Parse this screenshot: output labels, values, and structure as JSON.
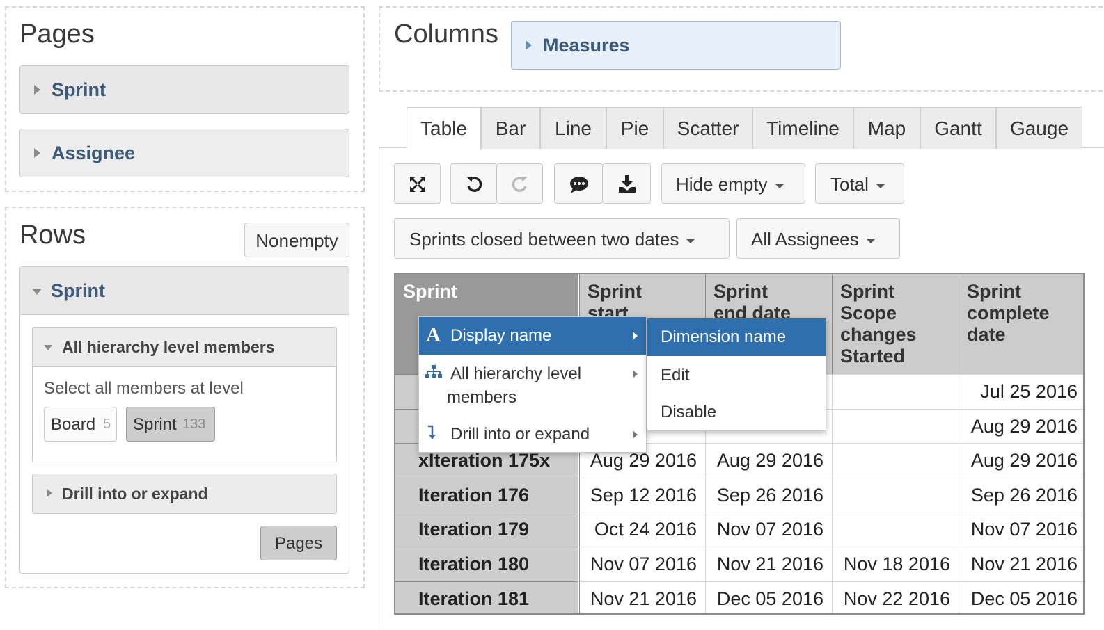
{
  "pages": {
    "title": "Pages",
    "dimensions": [
      "Sprint",
      "Assignee"
    ]
  },
  "rows": {
    "title": "Rows",
    "nonempty_label": "Nonempty",
    "dimension": "Sprint",
    "level_section": {
      "title": "All hierarchy level members",
      "hint": "Select all members at level",
      "levels": [
        {
          "name": "Board",
          "count": "5"
        },
        {
          "name": "Sprint",
          "count": "133"
        }
      ]
    },
    "drill_section": "Drill into or expand",
    "pages_button": "Pages"
  },
  "columns": {
    "title": "Columns",
    "measures": "Measures"
  },
  "tabs": [
    "Table",
    "Bar",
    "Line",
    "Pie",
    "Scatter",
    "Timeline",
    "Map",
    "Gantt",
    "Gauge"
  ],
  "active_tab": "Table",
  "toolbar": {
    "hide_empty": "Hide empty",
    "total": "Total",
    "filter_sprints": "Sprints closed between two dates",
    "filter_assignees": "All Assignees"
  },
  "icons": [
    "fullscreen-icon",
    "undo-icon",
    "redo-icon",
    "comment-icon",
    "download-icon"
  ],
  "table": {
    "header_row": "Sprint",
    "headers": [
      [
        "Sprint",
        "start"
      ],
      [
        "Sprint",
        "end date"
      ],
      [
        "Sprint",
        "Scope",
        "changes",
        "Started"
      ],
      [
        "Sprint",
        "complete",
        "date"
      ]
    ],
    "rows": [
      {
        "name": "",
        "start": "",
        "end": "",
        "scope": "",
        "complete": "Jul 25 2016"
      },
      {
        "name": "",
        "start": "",
        "end": "",
        "scope": "",
        "complete": "Aug 29 2016"
      },
      {
        "name": "xIteration 175x",
        "start": "Aug 29 2016",
        "end": "Aug 29 2016",
        "scope": "",
        "complete": "Aug 29 2016"
      },
      {
        "name": "Iteration 176",
        "start": "Sep 12 2016",
        "end": "Sep 26 2016",
        "scope": "",
        "complete": "Sep 26 2016"
      },
      {
        "name": "Iteration 179",
        "start": "Oct 24 2016",
        "end": "Nov 07 2016",
        "scope": "",
        "complete": "Nov 07 2016"
      },
      {
        "name": "Iteration 180",
        "start": "Nov 07 2016",
        "end": "Nov 21 2016",
        "scope": "Nov 18 2016",
        "complete": "Nov 21 2016"
      },
      {
        "name": "Iteration 181",
        "start": "Nov 21 2016",
        "end": "Dec 05 2016",
        "scope": "Nov 22 2016",
        "complete": "Dec 05 2016"
      }
    ]
  },
  "context_menu": {
    "items": [
      "Display name",
      "All hierarchy level members",
      "Drill into or expand"
    ],
    "item_line2": "members",
    "item_line1": "All hierarchy level",
    "icon_glyph": "A"
  },
  "submenu": {
    "items": [
      "Dimension name",
      "Edit",
      "Disable"
    ]
  },
  "colors": {
    "link_blue": "#3d5a7a",
    "menu_highlight": "#2f6fad",
    "header_dark": "#999999",
    "row_header": "#cdcdcd"
  }
}
